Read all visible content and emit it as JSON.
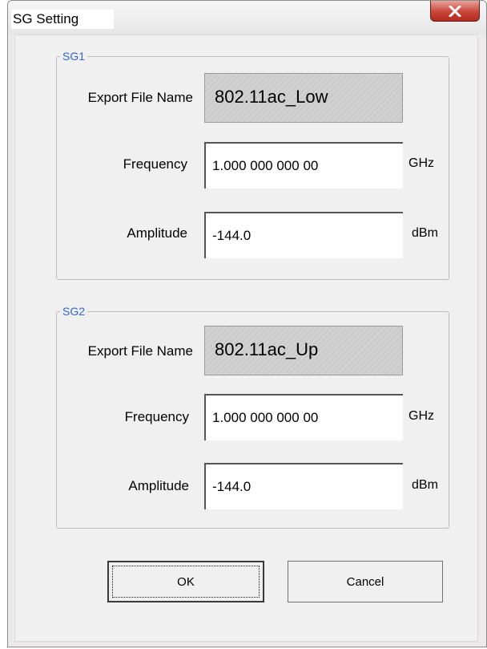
{
  "window": {
    "title": "SG Setting"
  },
  "sg1": {
    "legend": "SG1",
    "export_label": "Export File Name",
    "export_value": "802.11ac_Low",
    "frequency_label": "Frequency",
    "frequency_value": "1.000 000 000 00",
    "frequency_unit": "GHz",
    "amplitude_label": "Amplitude",
    "amplitude_value": "-144.0",
    "amplitude_unit": "dBm"
  },
  "sg2": {
    "legend": "SG2",
    "export_label": "Export File Name",
    "export_value": "802.11ac_Up",
    "frequency_label": "Frequency",
    "frequency_value": "1.000 000 000 00",
    "frequency_unit": "GHz",
    "amplitude_label": "Amplitude",
    "amplitude_value": "-144.0",
    "amplitude_unit": "dBm"
  },
  "buttons": {
    "ok": "OK",
    "cancel": "Cancel"
  },
  "icons": {
    "close": "close-icon"
  }
}
